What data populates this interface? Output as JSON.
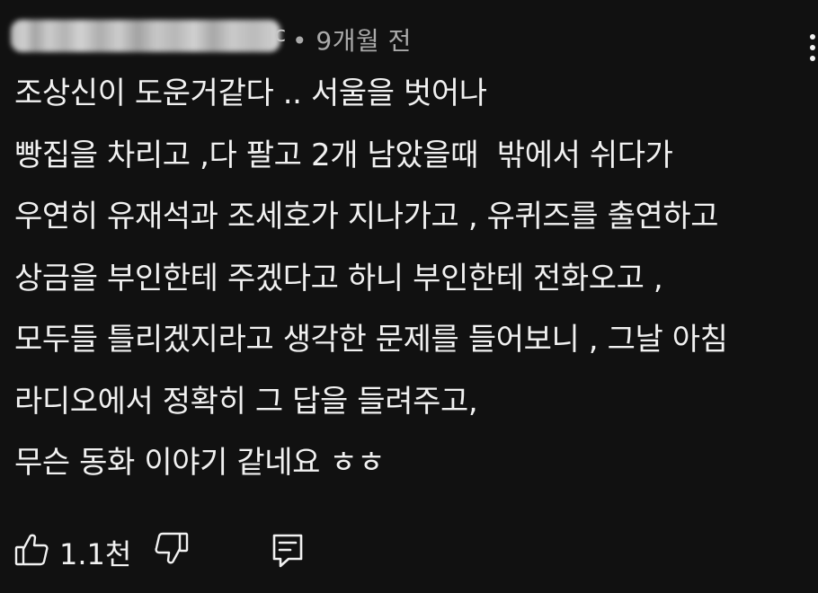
{
  "comment": {
    "author_suffix": "c",
    "separator": "•",
    "timestamp": "9개월 전",
    "lines": [
      "조상신이 도운거같다 .. 서울을 벗어나",
      "빵집을 차리고 ,다 팔고 2개 남았을때  밖에서 쉬다가",
      "우연히 유재석과 조세호가 지나가고 , 유퀴즈를 출연하고",
      "상금을 부인한테 주겠다고 하니 부인한테 전화오고 ,",
      "모두들 틀리겠지라고 생각한 문제를 들어보니 , 그날 아침",
      "라디오에서 정확히 그 답을 들려주고,",
      "무슨 동화 이야기 같네요 ㅎㅎ"
    ]
  },
  "actions": {
    "like_count": "1.1천"
  },
  "icons": {
    "like": "thumbs-up-icon",
    "dislike": "thumbs-down-icon",
    "reply": "reply-comment-icon",
    "menu": "more-vertical-icon"
  },
  "colors": {
    "background": "#111111",
    "text": "#f1f1f1",
    "secondary_text": "#aaaaaa"
  }
}
